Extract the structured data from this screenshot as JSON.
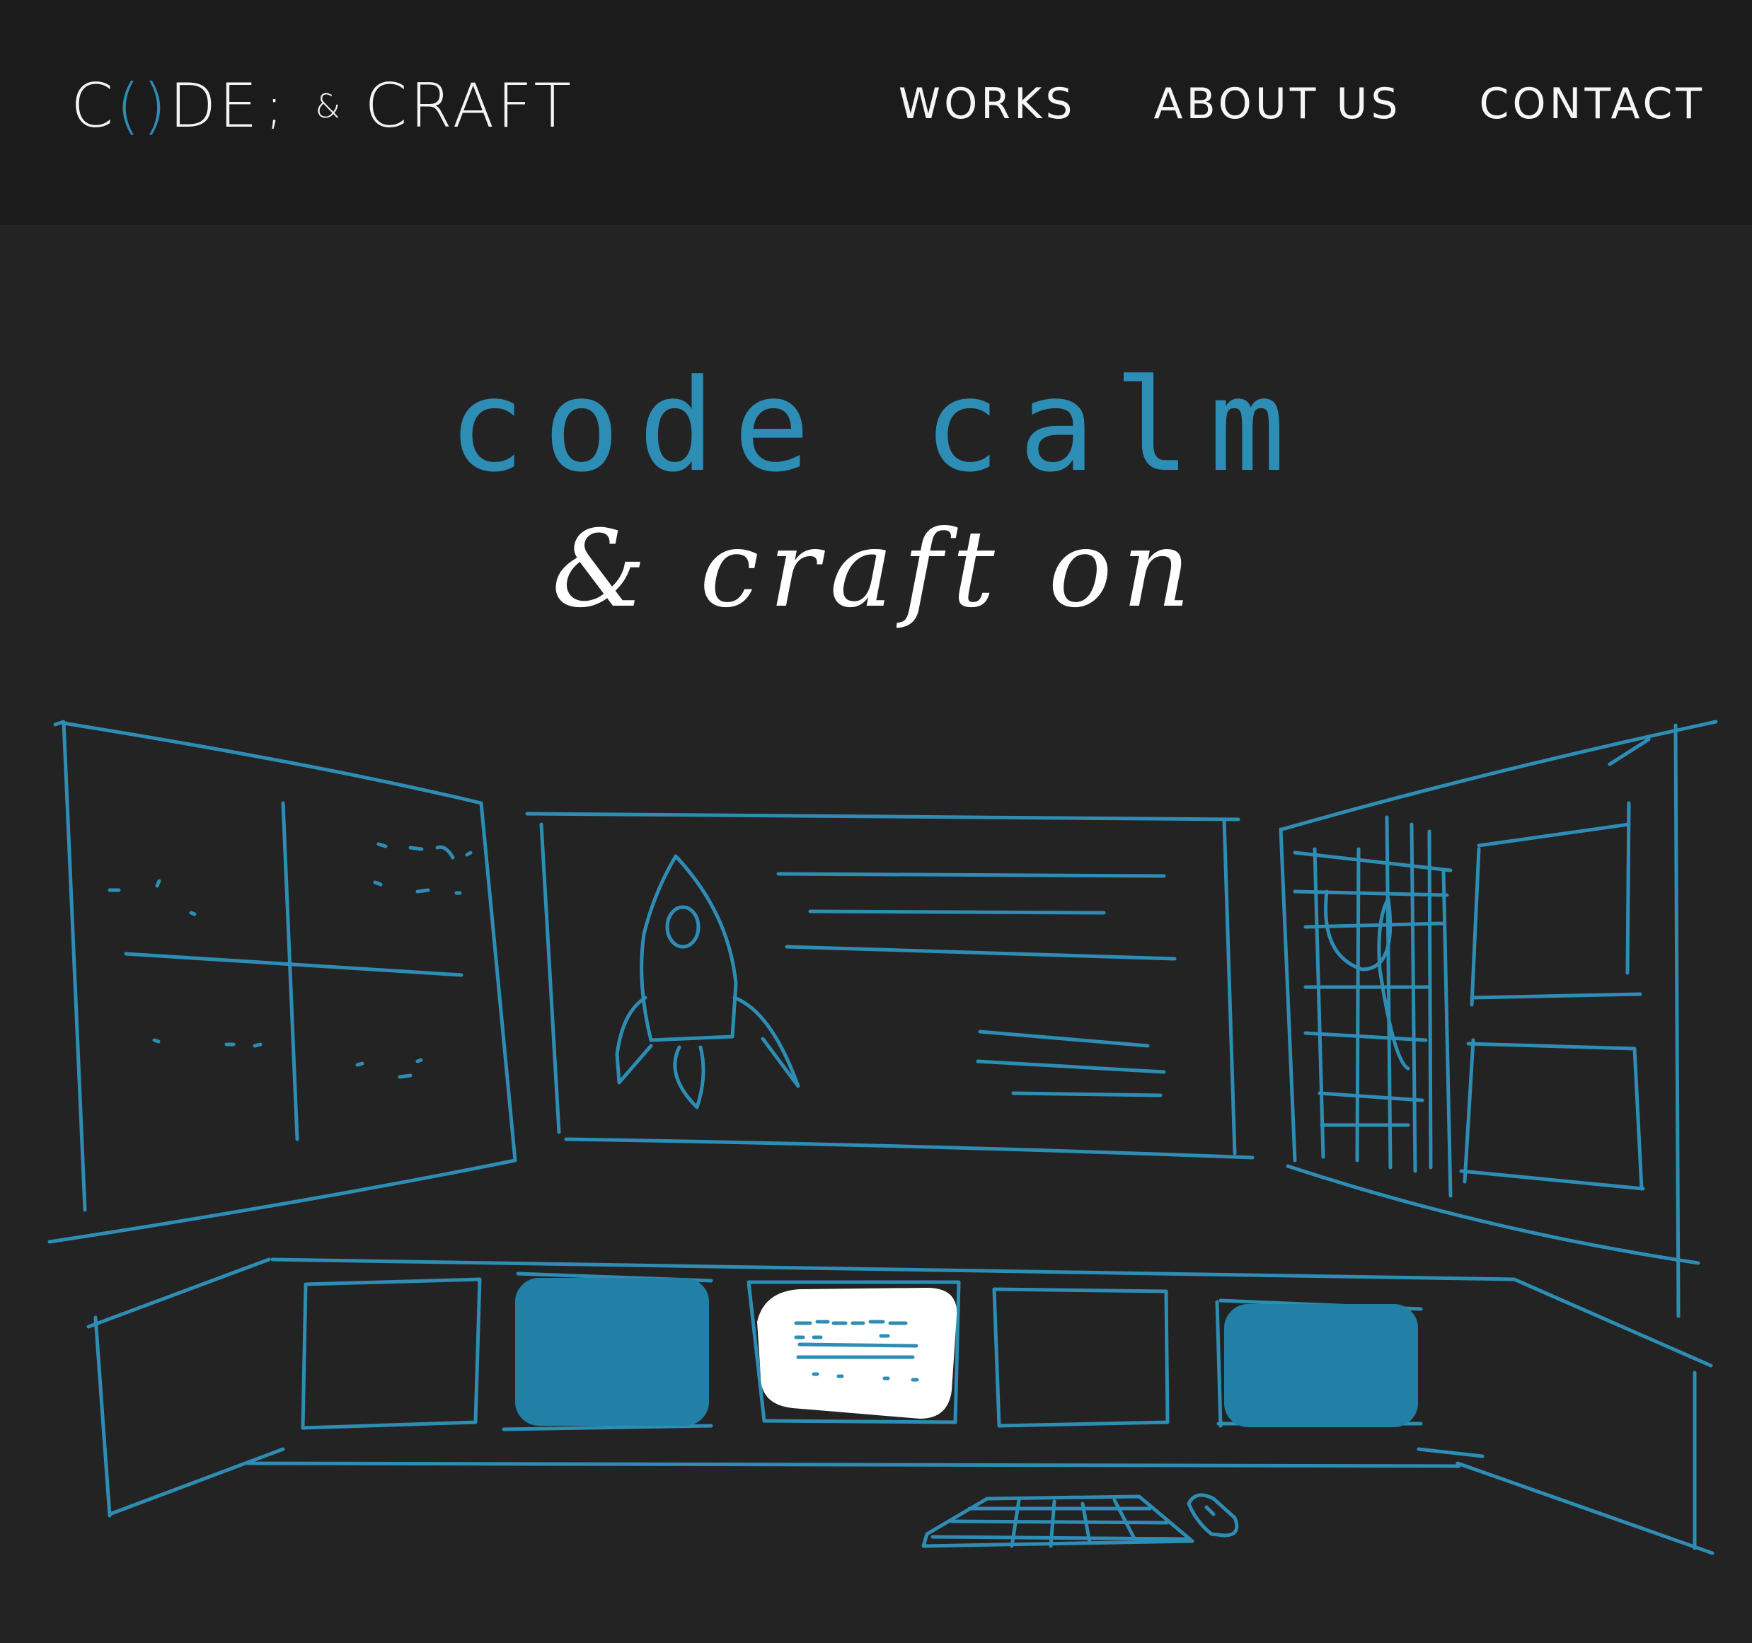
{
  "header": {
    "logo": {
      "parts": [
        "C",
        "(",
        ")",
        "DE",
        ";",
        "&",
        "CRAFT"
      ],
      "accent_color": "#2e8db4"
    },
    "nav": [
      {
        "label": "WORKS"
      },
      {
        "label": "ABOUT US"
      },
      {
        "label": "CONTACT"
      }
    ]
  },
  "hero": {
    "line1": "code calm",
    "line2": "& craft on"
  },
  "colors": {
    "background": "#232323",
    "header_background": "#1b1b1b",
    "accent": "#2e8db4",
    "text": "#ffffff"
  },
  "illustration": {
    "subject": "hand-drawn workspace with three wall screens, desk with five panels, keyboard and mouse",
    "icons": [
      "rocket-icon",
      "keyboard-icon",
      "mouse-icon"
    ]
  }
}
